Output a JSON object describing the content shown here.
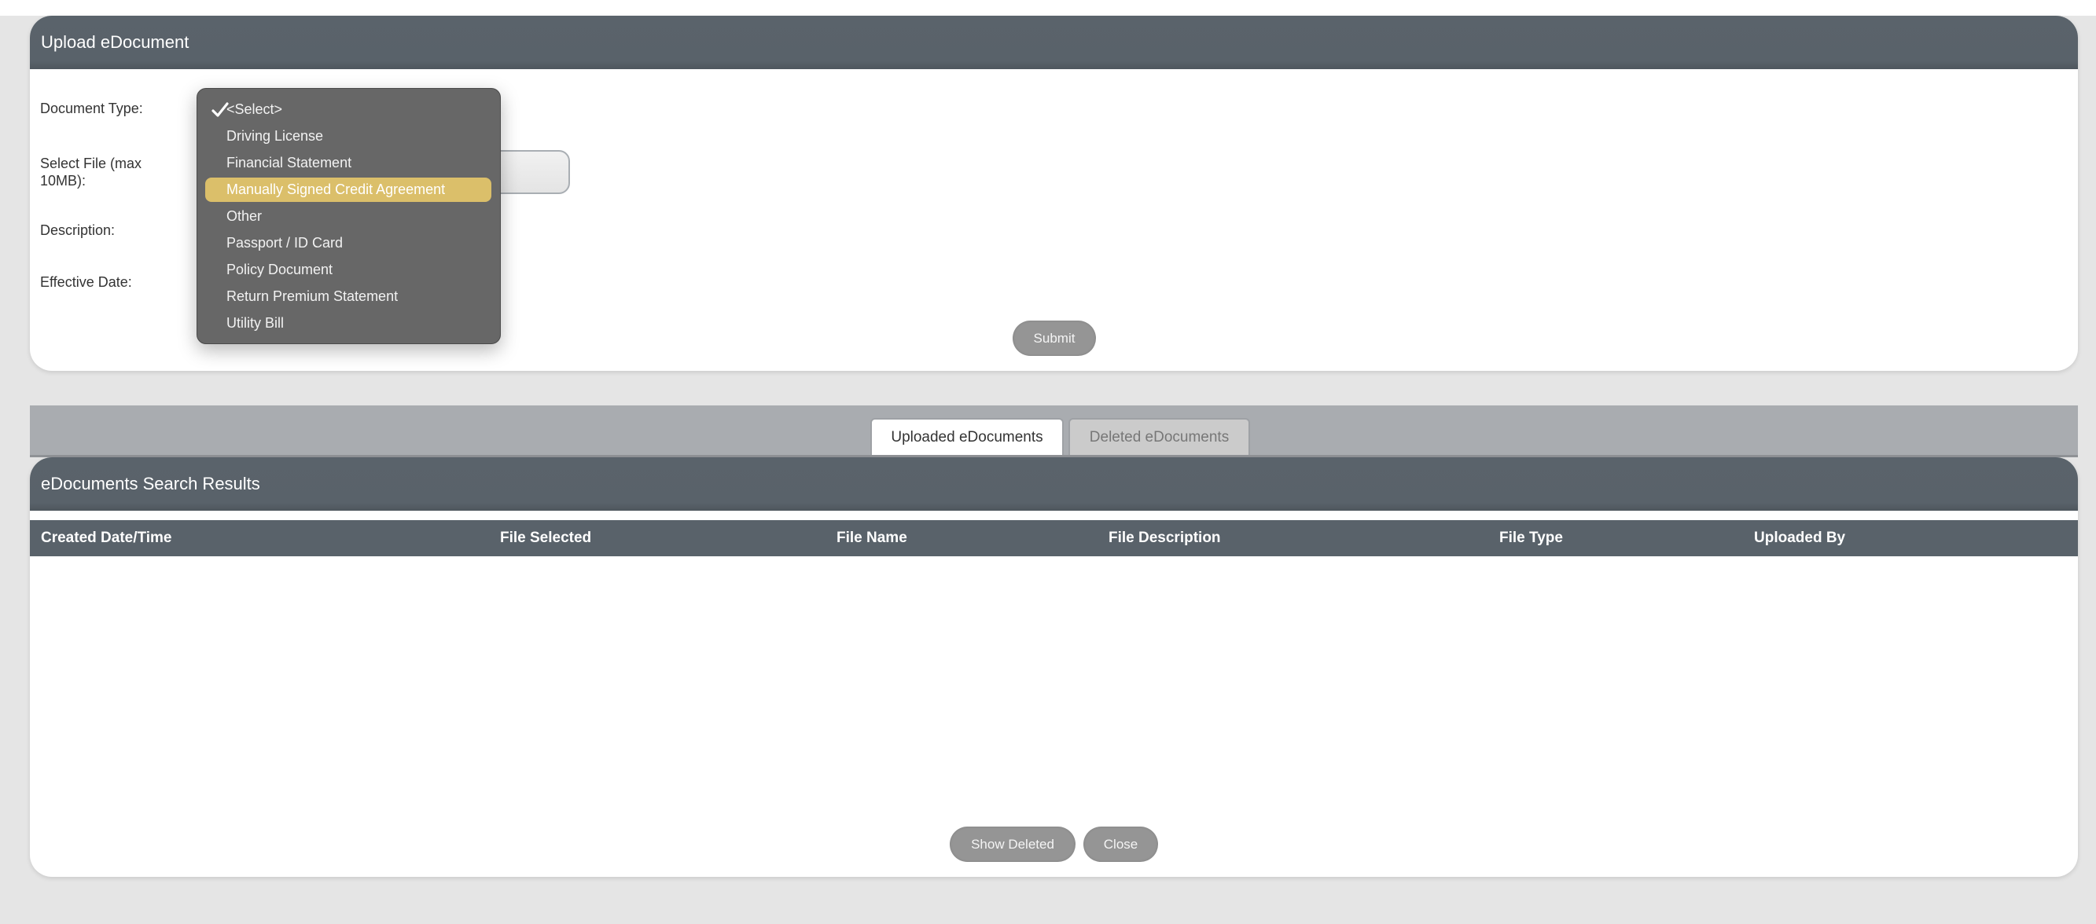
{
  "upload_panel": {
    "title": "Upload eDocument",
    "labels": {
      "document_type": "Document Type:",
      "select_file_line1": "Select File (max",
      "select_file_line2": "10MB):",
      "description": "Description:",
      "effective_date": "Effective Date:"
    },
    "submit_label": "Submit"
  },
  "document_type_dropdown": {
    "selected": "<Select>",
    "highlighted": "Manually Signed Credit Agreement",
    "options": [
      "<Select>",
      "Driving License",
      "Financial Statement",
      "Manually Signed Credit Agreement",
      "Other",
      "Passport / ID Card",
      "Policy Document",
      "Return Premium Statement",
      "Utility Bill"
    ],
    "highlight_color": "#dbbf6a"
  },
  "tabs": [
    {
      "label": "Uploaded eDocuments",
      "active": true
    },
    {
      "label": "Deleted eDocuments",
      "active": false
    }
  ],
  "results_panel": {
    "title": "eDocuments Search Results",
    "columns": [
      "Created Date/Time",
      "File Selected",
      "File Name",
      "File Description",
      "File Type",
      "Uploaded By"
    ],
    "rows": [],
    "show_deleted_label": "Show Deleted",
    "close_label": "Close"
  },
  "colors": {
    "header_bg": "#59626a",
    "button_bg": "#959595",
    "page_bg": "#e5e5e5"
  }
}
